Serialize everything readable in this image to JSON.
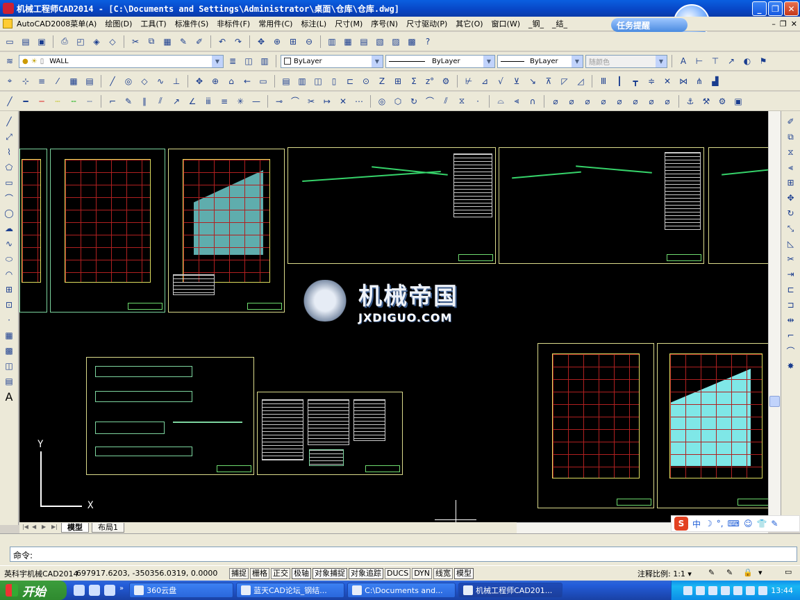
{
  "window": {
    "title": "机械工程师CAD2014 - [C:\\Documents and Settings\\Administrator\\桌面\\仓库\\仓库.dwg]"
  },
  "menu": {
    "items": [
      "AutoCAD2008菜单(A)",
      "绘图(D)",
      "工具(T)",
      "标准件(S)",
      "非标件(F)",
      "常用件(C)",
      "标注(L)",
      "尺寸(M)",
      "序号(N)",
      "尺寸驱动(P)",
      "其它(O)",
      "窗口(W)",
      "_钢_",
      "_结_"
    ],
    "task_remind": "任务提醒"
  },
  "layer_toolbar": {
    "current_layer": "WALL",
    "color": "ByLayer",
    "linetype": "ByLayer",
    "lineweight": "ByLayer",
    "plot_style": "随颜色"
  },
  "canvas": {
    "watermark_cn": "机械帝国",
    "watermark_en": "JXDIGUO.COM",
    "ucs_x": "X",
    "ucs_y": "Y"
  },
  "layout_tabs": [
    "模型",
    "布局1"
  ],
  "ime": {
    "label": "中"
  },
  "command": {
    "prompt": "命令:"
  },
  "status": {
    "app_name": "英科宇机械CAD2014",
    "coordinates": "697917.6203, -350356.0319, 0.0000",
    "toggles": [
      {
        "label": "捕捉",
        "on": false
      },
      {
        "label": "栅格",
        "on": false
      },
      {
        "label": "正交",
        "on": false
      },
      {
        "label": "极轴",
        "on": true
      },
      {
        "label": "对象捕捉",
        "on": true
      },
      {
        "label": "对象追踪",
        "on": true
      },
      {
        "label": "DUCS",
        "on": false
      },
      {
        "label": "DYN",
        "on": false
      },
      {
        "label": "线宽",
        "on": false
      },
      {
        "label": "模型",
        "on": true
      }
    ],
    "annotation_scale_label": "注释比例:",
    "annotation_scale_value": "1:1"
  },
  "taskbar": {
    "start_label": "开始",
    "tasks": [
      {
        "label": "360云盘",
        "active": false
      },
      {
        "label": "蓝天CAD论坛_钢结...",
        "active": false
      },
      {
        "label": "C:\\Documents and...",
        "active": false
      },
      {
        "label": "机械工程师CAD201...",
        "active": true
      }
    ],
    "clock": "13:44"
  }
}
